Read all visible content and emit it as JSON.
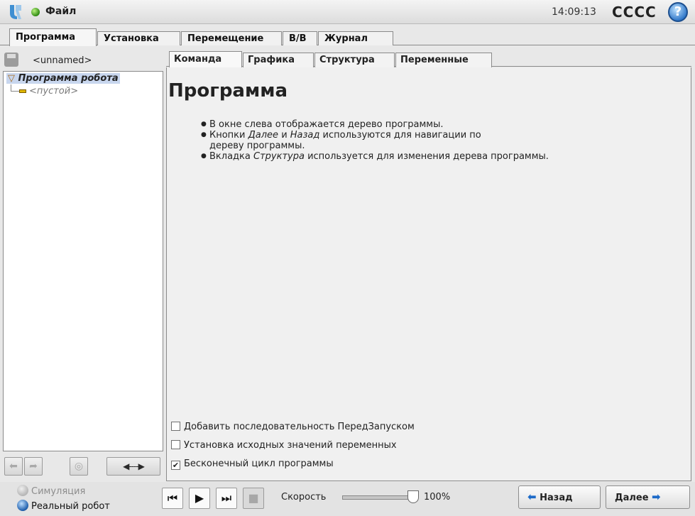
{
  "header": {
    "file_menu": "Файл",
    "clock": "14:09:13",
    "robot_name": "CCCC",
    "help": "?",
    "status_color": "#2f8a12"
  },
  "main_tabs": [
    {
      "label": "Программа",
      "active": true
    },
    {
      "label": "Установка",
      "active": false
    },
    {
      "label": "Перемещение",
      "active": false
    },
    {
      "label": "В/В",
      "active": false
    },
    {
      "label": "Журнал",
      "active": false
    }
  ],
  "left": {
    "program_file": "<unnamed>",
    "tree": {
      "root": "Программа робота",
      "child": "<пустой>"
    },
    "tree_buttons": {
      "move_up": "⬅",
      "move_down": "➦",
      "suppress": "◎",
      "toggle": "◀----▶"
    }
  },
  "sub_tabs": [
    {
      "label": "Команда",
      "active": true
    },
    {
      "label": "Графика",
      "active": false
    },
    {
      "label": "Структура",
      "active": false
    },
    {
      "label": "Переменные",
      "active": false
    }
  ],
  "content": {
    "title": "Программа",
    "bullets": [
      {
        "parts": [
          "В окне слева отображается дерево программы."
        ]
      },
      {
        "parts": [
          "Кнопки ",
          "Далее",
          " и ",
          "Назад",
          " используются для навигации по",
          "дереву программы."
        ]
      },
      {
        "parts": [
          "Вкладка ",
          "Структура",
          " используется для изменения дерева программы."
        ]
      }
    ],
    "options": [
      {
        "label": "Добавить последовательность ПередЗапуском",
        "checked": false
      },
      {
        "label": "Установка исходных значений переменных",
        "checked": false
      },
      {
        "label": "Бесконечный цикл программы",
        "checked": true
      }
    ]
  },
  "bottom": {
    "mode_sim": "Симуляция",
    "mode_real": "Реальный робот",
    "speed_label": "Скорость",
    "speed_value": "100%",
    "speed_fraction": 1.0,
    "back": "Назад",
    "next": "Далее",
    "arrow_color": "#1c6ac8"
  }
}
